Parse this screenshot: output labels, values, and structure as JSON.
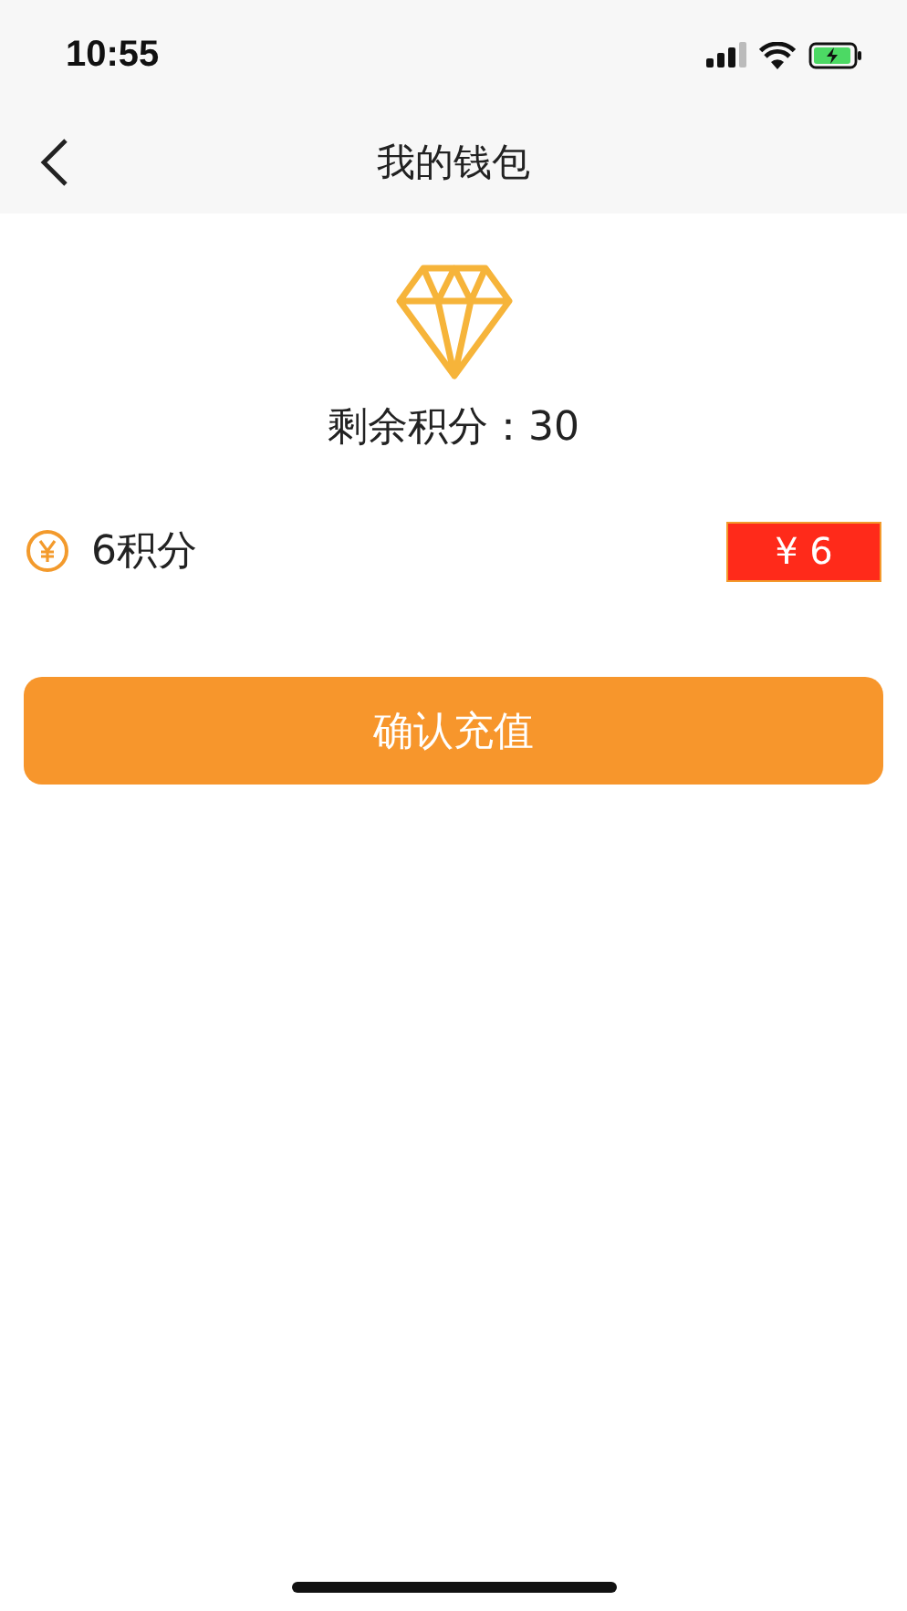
{
  "status_bar": {
    "time": "10:55"
  },
  "nav": {
    "title": "我的钱包"
  },
  "balance": {
    "text": "剩余积分：30"
  },
  "packages": [
    {
      "label": "6积分",
      "price": "¥ 6"
    }
  ],
  "confirm_button": {
    "label": "确认充值"
  }
}
